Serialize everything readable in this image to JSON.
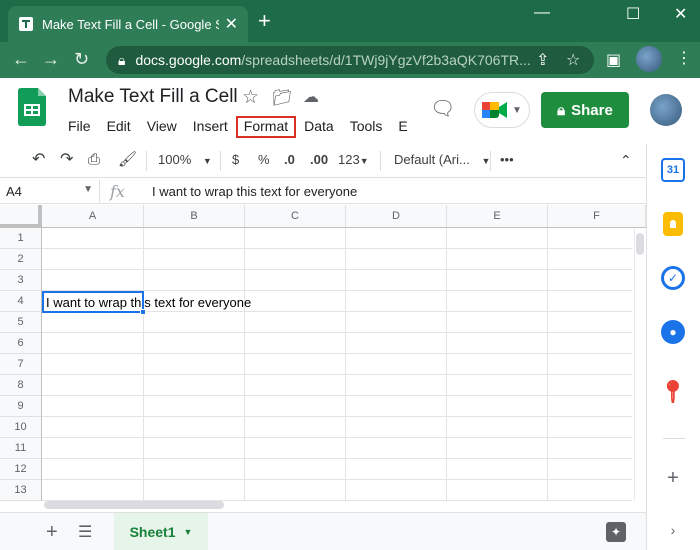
{
  "browser": {
    "tab_title": "Make Text Fill a Cell - Google She",
    "tab_close": "✕",
    "new_tab": "+",
    "window_controls": {
      "minimize": "—",
      "maximize": "☐",
      "close": "✕"
    },
    "url_host": "docs.google.com",
    "url_path": "/spreadsheets/d/1TWj9jYgzVf2b3aQK706TR...",
    "icons": [
      "back-icon",
      "forward-icon",
      "reload-icon",
      "lock-icon",
      "share-page-icon",
      "bookmark-star-icon",
      "side-panel-icon",
      "profile-avatar",
      "menu-kebab-icon"
    ]
  },
  "doc": {
    "title": "Make Text Fill a Cell",
    "menu": [
      "File",
      "Edit",
      "View",
      "Insert",
      "Format",
      "Data",
      "Tools",
      "E"
    ],
    "highlighted_menu": "Format",
    "share_label": "Share",
    "share_color": "#1e8e3e",
    "highlight_color": "#d93025"
  },
  "toolbar": {
    "zoom": "100%",
    "currency": "$",
    "percent": "%",
    "decrease_decimal": ".0",
    "increase_decimal": ".00",
    "number_format": "123",
    "font": "Default (Ari...",
    "more": "•••"
  },
  "formula_bar": {
    "cell_ref": "A4",
    "fx": "fx",
    "value": "I want to wrap this text for everyone"
  },
  "grid": {
    "columns": [
      "A",
      "B",
      "C",
      "D",
      "E",
      "F"
    ],
    "rows": [
      "1",
      "2",
      "3",
      "4",
      "5",
      "6",
      "7",
      "8",
      "9",
      "10",
      "11",
      "12",
      "13"
    ],
    "cell_a4": "I want to wrap this text for everyone",
    "selection_color": "#1a73e8"
  },
  "sheets": {
    "active": "Sheet1"
  },
  "side_panel": {
    "calendar_day": "31",
    "icons": [
      "calendar-icon",
      "keep-icon",
      "tasks-icon",
      "contacts-icon",
      "maps-icon",
      "add-on-icon",
      "expand-panel-icon"
    ]
  }
}
